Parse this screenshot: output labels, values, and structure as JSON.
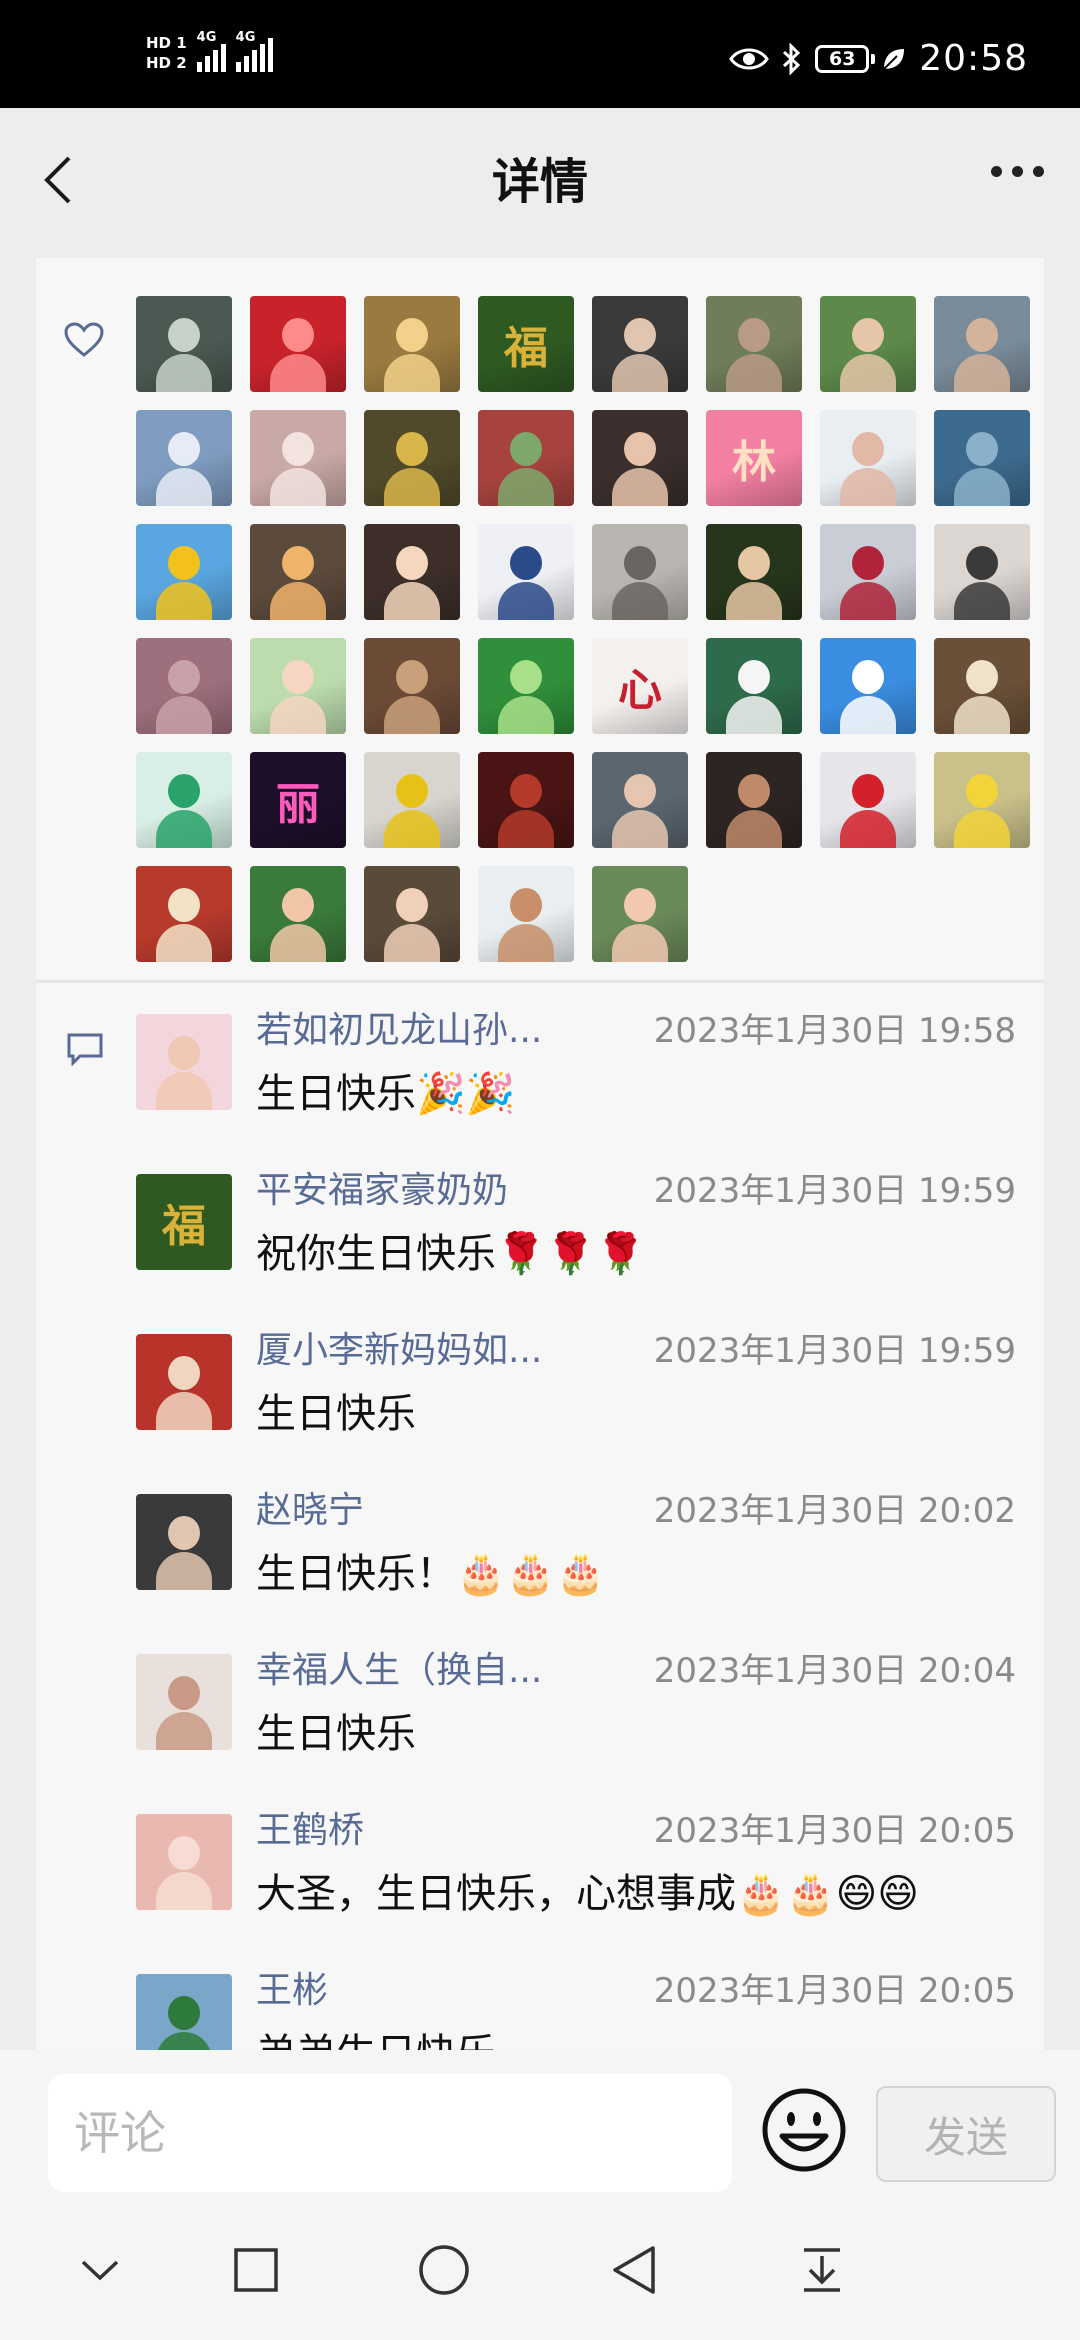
{
  "status_bar": {
    "sim1": "HD 1",
    "sim2": "HD 2",
    "net1": "4G",
    "net2": "4G",
    "battery": "63",
    "time": "20:58"
  },
  "header": {
    "title": "详情"
  },
  "likes": {
    "icon": "heart-outline-icon",
    "avatars": [
      {
        "bg": "#4a5a52",
        "fg": "#c7d2c9"
      },
      {
        "bg": "#c8232b",
        "fg": "#ff8a8a"
      },
      {
        "bg": "#9a7a40",
        "fg": "#f3d18a"
      },
      {
        "bg": "#2e5a22",
        "fg": "#d9b23a",
        "glyph": "福"
      },
      {
        "bg": "#3a3a3a",
        "fg": "#e0c6b0"
      },
      {
        "bg": "#6f7d5a",
        "fg": "#b89a86"
      },
      {
        "bg": "#5d8a4a",
        "fg": "#e5c6a8"
      },
      {
        "bg": "#7a8c9a",
        "fg": "#d3b39a"
      },
      {
        "bg": "#7f9cc0",
        "fg": "#e6ecf5"
      },
      {
        "bg": "#c9a9a6",
        "fg": "#f2e3df"
      },
      {
        "bg": "#514a2a",
        "fg": "#d9b64a"
      },
      {
        "bg": "#a7433e",
        "fg": "#7ea86b"
      },
      {
        "bg": "#3a2f2c",
        "fg": "#e7c3ab"
      },
      {
        "bg": "#f37fa2",
        "fg": "#ffe0c2",
        "glyph": "林"
      },
      {
        "bg": "#e9eef3",
        "fg": "#e2b9a6"
      },
      {
        "bg": "#3d6b8f",
        "fg": "#8ab1c9"
      },
      {
        "bg": "#5aa6e0",
        "fg": "#f2c21b"
      },
      {
        "bg": "#5c4a3c",
        "fg": "#f0b36a"
      },
      {
        "bg": "#3d2e2a",
        "fg": "#f4d7bd"
      },
      {
        "bg": "#eef0f5",
        "fg": "#2a4a8a"
      },
      {
        "bg": "#b9b5b0",
        "fg": "#6a6560"
      },
      {
        "bg": "#26361c",
        "fg": "#e6c7a4"
      },
      {
        "bg": "#c9ced6",
        "fg": "#b1233a"
      },
      {
        "bg": "#dcd6d2",
        "fg": "#3a3a3a"
      },
      {
        "bg": "#9e6f7d",
        "fg": "#c9a1aa"
      },
      {
        "bg": "#bcdcae",
        "fg": "#f6d6c2"
      },
      {
        "bg": "#6b4a36",
        "fg": "#c9a07a"
      },
      {
        "bg": "#2f8f3a",
        "fg": "#a8e08a"
      },
      {
        "bg": "#f3f0ee",
        "fg": "#c71f2f",
        "glyph": "心"
      },
      {
        "bg": "#2e6b4a",
        "fg": "#f5f5f5"
      },
      {
        "bg": "#3a8de0",
        "fg": "#ffffff"
      },
      {
        "bg": "#6a5038",
        "fg": "#efe2c8"
      },
      {
        "bg": "#d8efe5",
        "fg": "#2aa36a"
      },
      {
        "bg": "#1d0f2a",
        "fg": "#ff5bbd",
        "glyph": "丽"
      },
      {
        "bg": "#d8d5cf",
        "fg": "#e6c217"
      },
      {
        "bg": "#4a1414",
        "fg": "#b33a2a"
      },
      {
        "bg": "#5b6670",
        "fg": "#e6c6b0"
      },
      {
        "bg": "#2d2522",
        "fg": "#c08a6a"
      },
      {
        "bg": "#e6e6ea",
        "fg": "#d3202a"
      },
      {
        "bg": "#c9c08a",
        "fg": "#f2d43a"
      },
      {
        "bg": "#b83a2c",
        "fg": "#f2e3c8"
      },
      {
        "bg": "#3a7a3a",
        "fg": "#f0c6a6"
      },
      {
        "bg": "#5a4a3a",
        "fg": "#f0d0b8"
      },
      {
        "bg": "#e9eef0",
        "fg": "#c88f6a"
      },
      {
        "bg": "#6b8a5a",
        "fg": "#f2c8b0"
      }
    ]
  },
  "comments": {
    "icon": "comment-bubble-icon",
    "items": [
      {
        "name": "若如初见龙山孙...",
        "time": "2023年1月30日 19:58",
        "text": "生日快乐🎉🎉",
        "bg": "#f3d6dc",
        "fg": "#f0c8b4"
      },
      {
        "name": "平安福家豪奶奶",
        "time": "2023年1月30日 19:59",
        "text": "祝你生日快乐🌹🌹🌹",
        "bg": "#2e5a22",
        "fg": "#d9b23a",
        "glyph": "福"
      },
      {
        "name": "厦小李新妈妈如...",
        "time": "2023年1月30日 19:59",
        "text": "生日快乐",
        "bg": "#b8332a",
        "fg": "#f0d6c0"
      },
      {
        "name": "赵晓宁",
        "time": "2023年1月30日 20:02",
        "text": "生日快乐！🎂🎂🎂",
        "bg": "#3a3a3a",
        "fg": "#e0c6b0"
      },
      {
        "name": "幸福人生（换自...",
        "time": "2023年1月30日 20:04",
        "text": "生日快乐",
        "bg": "#e9e0dc",
        "fg": "#c99a86"
      },
      {
        "name": "王鹤桥",
        "time": "2023年1月30日 20:05",
        "text": "大圣，生日快乐，心想事成🎂🎂😄😄",
        "bg": "#e9b8b0",
        "fg": "#f6dcd2"
      },
      {
        "name": "王彬",
        "time": "2023年1月30日 20:05",
        "text": "弟弟生日快乐",
        "bg": "#7aa6c9",
        "fg": "#2e7a3a"
      }
    ]
  },
  "input": {
    "placeholder": "评论",
    "emoji_icon": "smiley-face-icon",
    "send_label": "发送"
  },
  "nav": {
    "icons": [
      "chevron-down-icon",
      "recent-apps-square-icon",
      "home-circle-icon",
      "back-triangle-icon",
      "download-tray-icon"
    ]
  }
}
